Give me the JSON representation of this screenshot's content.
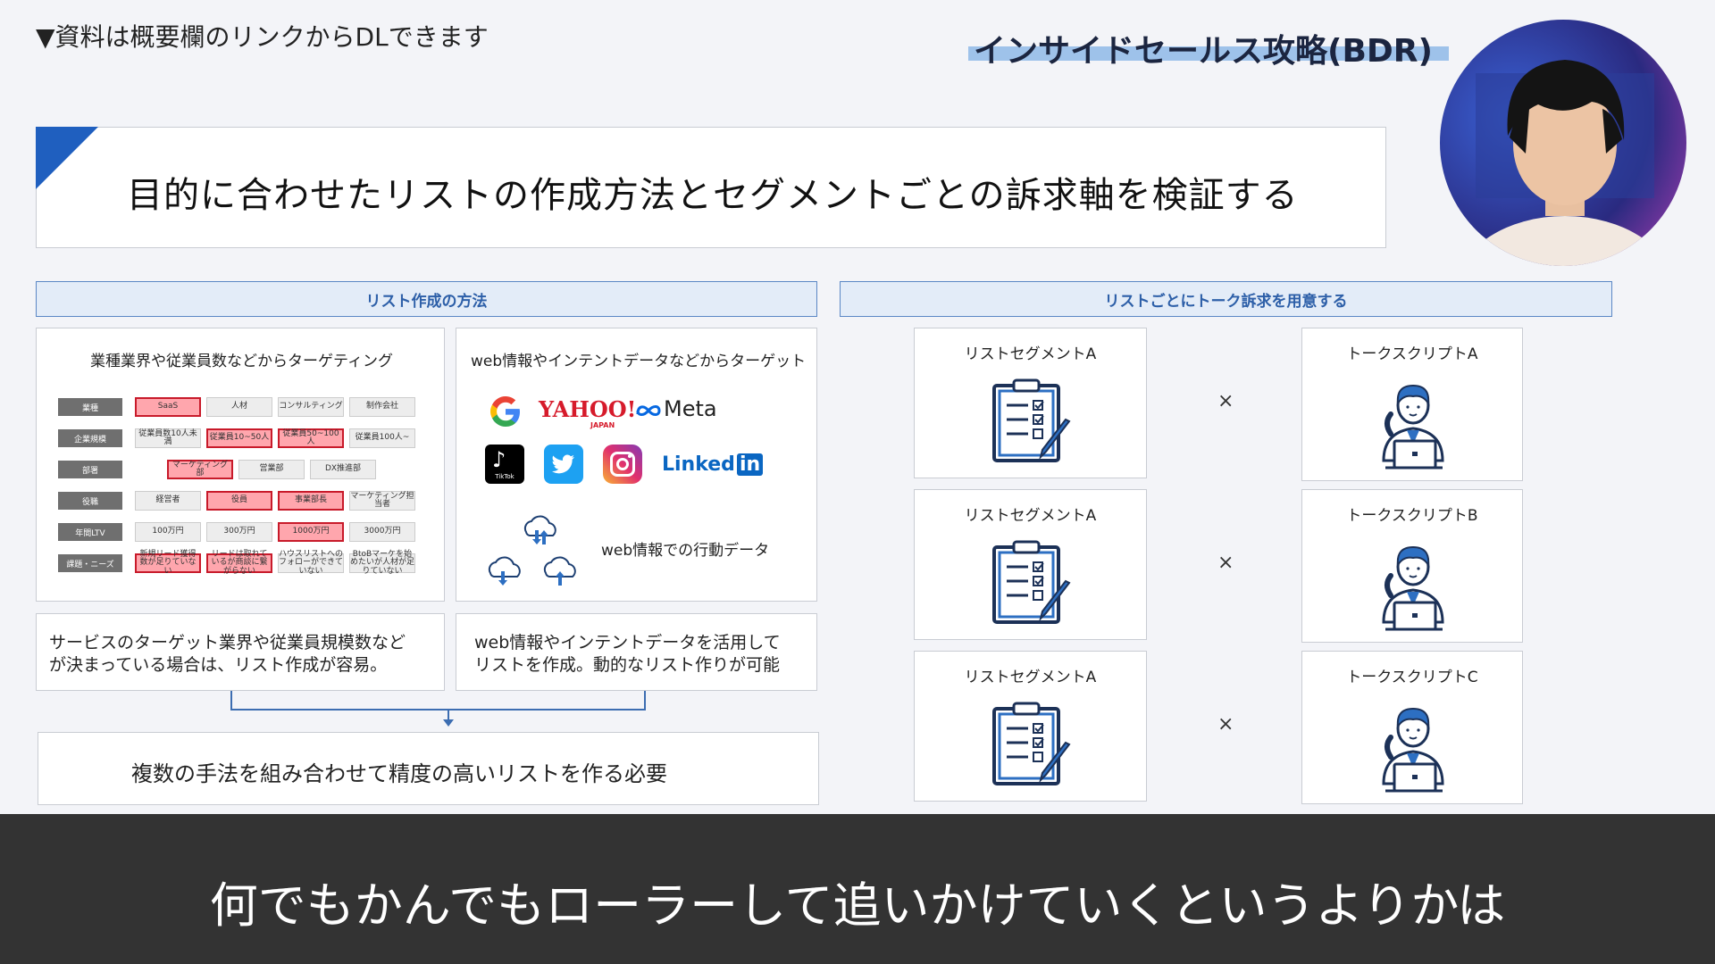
{
  "notice": "▼資料は概要欄のリンクからDLできます",
  "series_title": "インサイドセールス攻略(BDR)",
  "headline": "目的に合わせたリストの作成方法とセグメントごとの訴求軸を検証する",
  "left_section": {
    "header": "リスト作成の方法",
    "card1_title": "業種業界や従業員数などからターゲティング",
    "matrix": [
      {
        "label": "業種",
        "cells": [
          {
            "t": "SaaS",
            "hl": true,
            "w": 74
          },
          {
            "t": "人材",
            "hl": false,
            "w": 74
          },
          {
            "t": "コンサルティング",
            "hl": false,
            "w": 74
          },
          {
            "t": "制作会社",
            "hl": false,
            "w": 74
          }
        ]
      },
      {
        "label": "企業規模",
        "cells": [
          {
            "t": "従業員数10人未満",
            "hl": false,
            "w": 74
          },
          {
            "t": "従業員10~50人",
            "hl": true,
            "w": 74
          },
          {
            "t": "従業員50~100人",
            "hl": true,
            "w": 74
          },
          {
            "t": "従業員100人~",
            "hl": false,
            "w": 74
          }
        ]
      },
      {
        "label": "部署",
        "cells": [
          {
            "t": "マーケティング部",
            "hl": true,
            "w": 74,
            "off": 36
          },
          {
            "t": "営業部",
            "hl": false,
            "w": 74
          },
          {
            "t": "DX推進部",
            "hl": false,
            "w": 74
          }
        ]
      },
      {
        "label": "役職",
        "cells": [
          {
            "t": "経営者",
            "hl": false,
            "w": 74
          },
          {
            "t": "役員",
            "hl": true,
            "w": 74
          },
          {
            "t": "事業部長",
            "hl": true,
            "w": 74
          },
          {
            "t": "マーケティング担当者",
            "hl": false,
            "w": 74
          }
        ]
      },
      {
        "label": "年間LTV",
        "cells": [
          {
            "t": "100万円",
            "hl": false,
            "w": 74
          },
          {
            "t": "300万円",
            "hl": false,
            "w": 74
          },
          {
            "t": "1000万円",
            "hl": true,
            "w": 74
          },
          {
            "t": "3000万円",
            "hl": false,
            "w": 74
          }
        ]
      },
      {
        "label": "課題・ニーズ",
        "cells": [
          {
            "t": "新規リード獲得数が足りていない",
            "hl": true,
            "w": 74
          },
          {
            "t": "リードは取れているが商談に繋がらない",
            "hl": true,
            "w": 74
          },
          {
            "t": "ハウスリストへのフォローができていない",
            "hl": false,
            "w": 74
          },
          {
            "t": "BtoBマーケを始めたいが人材が足りていない",
            "hl": false,
            "w": 74
          }
        ]
      }
    ],
    "card2_title": "web情報やインテントデータなどからターゲット",
    "logos": {
      "yahoo": "YAHOO!",
      "yahoo_sub": "JAPAN",
      "meta": "Meta",
      "tiktok": "TikTok",
      "linkedin": "Linked",
      "linkedin_in": "in"
    },
    "behavior_label": "web情報での行動データ",
    "desc1": [
      "サービスのターゲット業界や従業員規模数など",
      "が決まっている場合は、リスト作成が容易。"
    ],
    "desc2": [
      "web情報やインテントデータを活用して",
      "リストを作成。動的なリスト作りが可能"
    ],
    "conclusion": "複数の手法を組み合わせて精度の高いリストを作る必要"
  },
  "right_section": {
    "header": "リストごとにトーク訴求を用意する",
    "rows": [
      {
        "segment": "リストセグメントA",
        "times": "×",
        "script": "トークスクリプトA"
      },
      {
        "segment": "リストセグメントA",
        "times": "×",
        "script": "トークスクリプトB"
      },
      {
        "segment": "リストセグメントA",
        "times": "×",
        "script": "トークスクリプトC"
      }
    ]
  },
  "caption": "何でもかんでもローラーして追いかけていくというよりかは",
  "colors": {
    "accent": "#1f5fbf",
    "highlight_red": "#c81a2a",
    "caption_bg": "#333333"
  }
}
